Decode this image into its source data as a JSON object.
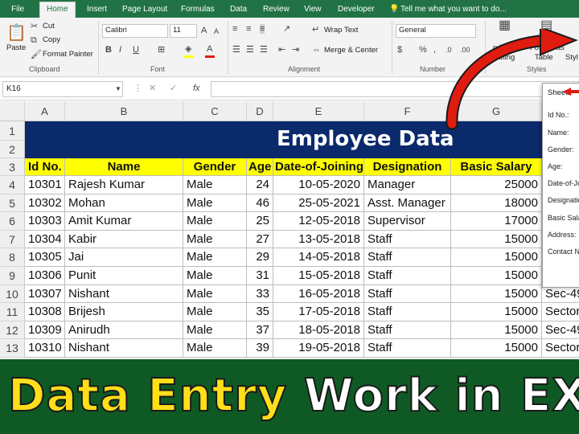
{
  "tabs": [
    "File",
    "Home",
    "Insert",
    "Page Layout",
    "Formulas",
    "Data",
    "Review",
    "View",
    "Developer"
  ],
  "tell_me": "Tell me what you want to do...",
  "ribbon": {
    "clipboard": {
      "paste": "Paste",
      "cut": "Cut",
      "copy": "Copy",
      "format_painter": "Format Painter",
      "label": "Clipboard"
    },
    "font": {
      "name": "Calibri",
      "size": "11",
      "label": "Font",
      "bold": "B",
      "italic": "I",
      "underline": "U"
    },
    "alignment": {
      "wrap_text": "Wrap Text",
      "merge_center": "Merge & Center",
      "label": "Alignment"
    },
    "number": {
      "format": "General",
      "label": "Number"
    },
    "styles": {
      "conditional": "nditional",
      "formatting": "rmatting",
      "format_as": "Format as",
      "table": "Table",
      "style": "Styl",
      "label": "Styles"
    }
  },
  "formula_bar": {
    "name_box": "K16",
    "fx": "fx"
  },
  "columns": [
    "A",
    "B",
    "C",
    "D",
    "E",
    "F",
    "G"
  ],
  "title": "Employee Data",
  "headers": [
    "Id No.",
    "Name",
    "Gender",
    "Age",
    "Date-of-Joining",
    "Designation",
    "Basic Salary"
  ],
  "rows": [
    {
      "n": "4",
      "id": "10301",
      "name": "Rajesh Kumar",
      "gender": "Male",
      "age": "24",
      "doj": "10-05-2020",
      "desig": "Manager",
      "salary": "25000",
      "extra": ""
    },
    {
      "n": "5",
      "id": "10302",
      "name": "Mohan",
      "gender": "Male",
      "age": "46",
      "doj": "25-05-2021",
      "desig": "Asst. Manager",
      "salary": "18000",
      "extra": ""
    },
    {
      "n": "6",
      "id": "10303",
      "name": "Amit Kumar",
      "gender": "Male",
      "age": "25",
      "doj": "12-05-2018",
      "desig": "Supervisor",
      "salary": "17000",
      "extra": ""
    },
    {
      "n": "7",
      "id": "10304",
      "name": "Kabir",
      "gender": "Male",
      "age": "27",
      "doj": "13-05-2018",
      "desig": "Staff",
      "salary": "15000",
      "extra": ""
    },
    {
      "n": "8",
      "id": "10305",
      "name": "Jai",
      "gender": "Male",
      "age": "29",
      "doj": "14-05-2018",
      "desig": "Staff",
      "salary": "15000",
      "extra": ""
    },
    {
      "n": "9",
      "id": "10306",
      "name": "Punit",
      "gender": "Male",
      "age": "31",
      "doj": "15-05-2018",
      "desig": "Staff",
      "salary": "15000",
      "extra": ""
    },
    {
      "n": "10",
      "id": "10307",
      "name": "Nishant",
      "gender": "Male",
      "age": "33",
      "doj": "16-05-2018",
      "desig": "Staff",
      "salary": "15000",
      "extra": "Sec-49"
    },
    {
      "n": "11",
      "id": "10308",
      "name": "Brijesh",
      "gender": "Male",
      "age": "35",
      "doj": "17-05-2018",
      "desig": "Staff",
      "salary": "15000",
      "extra": "Sector-"
    },
    {
      "n": "12",
      "id": "10309",
      "name": "Anirudh",
      "gender": "Male",
      "age": "37",
      "doj": "18-05-2018",
      "desig": "Staff",
      "salary": "15000",
      "extra": "Sec-49"
    },
    {
      "n": "13",
      "id": "10310",
      "name": "Nishant",
      "gender": "Male",
      "age": "39",
      "doj": "19-05-2018",
      "desig": "Staff",
      "salary": "15000",
      "extra": "Sector-"
    }
  ],
  "dialog": {
    "title": "Sheet1",
    "labels": [
      "Id No.:",
      "Name:",
      "Gender:",
      "Age:",
      "Date-of-Jo",
      "Designatio",
      "Basic Sala",
      "Address:",
      "Contact N"
    ]
  },
  "banner": {
    "part1": "Data Entry",
    "part2": "Work in EX"
  },
  "colors": {
    "excel_green": "#217346",
    "title_fill": "#0b2a6b",
    "header_fill": "#ffff00",
    "banner_bg": "#0f5a24",
    "banner_yellow": "#ffde1a",
    "arrow_red": "#e01b10"
  }
}
